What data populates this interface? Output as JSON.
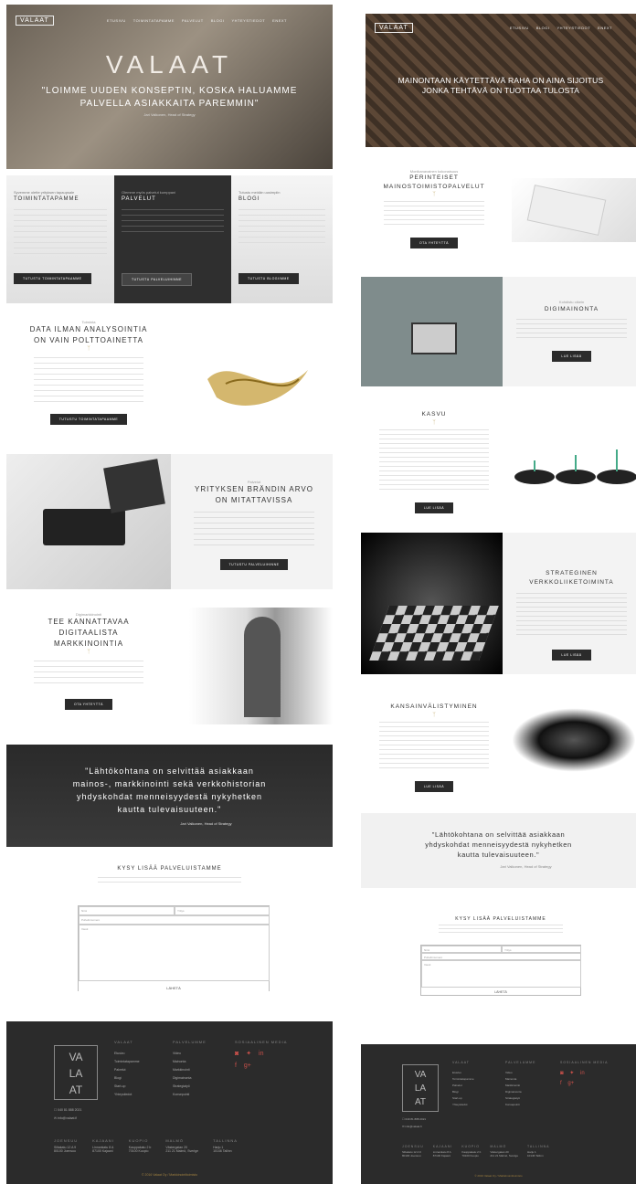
{
  "left": {
    "nav": {
      "logo": "VALAAT",
      "items": [
        "ETUSIVU",
        "TOIMINTATAPAMME",
        "PALVELUT",
        "BLOGI",
        "YHTEYSTIEDOT",
        "ENEXT"
      ]
    },
    "hero": {
      "logo": "VALAAT",
      "quote_line1": "\"LOIMME UUDEN KONSEPTIN, KOSKA HALUAMME",
      "quote_line2": "PALVELLA ASIAKKAITA PAREMMIN\"",
      "author": "Jari Valkonen, Head of Strategy"
    },
    "tiles": [
      {
        "kicker": "Syvemme olette yrityksen tapaupsale",
        "title": "TOIMINTATAPAMME",
        "button": "TUTUSTU TOIMINTATAPAAMME"
      },
      {
        "kicker": "Olemme myös palvelut kumppani",
        "title": "PALVELUT",
        "button": "TUTUSTU PALVELUIHINNE"
      },
      {
        "kicker": "Tutustu meidän uusimpiin",
        "title": "BLOGI",
        "button": "TUTUSTU BLOGIIMME"
      }
    ],
    "data": {
      "kicker": "Toiminta",
      "title1": "DATA ILMAN ANALYSOINTIA",
      "title2": "ON VAIN POLTTOAINETTA",
      "button": "TUTUSTU TOIMINTATAPAAMME"
    },
    "brand": {
      "kicker": "Palvelut",
      "title1": "YRITYKSEN BRÄNDIN ARVO",
      "title2": "ON MITATTAVISSA",
      "button": "TUTUSTU PALVELUIHINNE"
    },
    "marketing": {
      "kicker": "Digimarkkinointi",
      "title1": "TEE KANNATTAVAA",
      "title2": "DIGITAALISTA",
      "title3": "MARKKINOINTIA",
      "button": "OTA YHTEYTTÄ"
    },
    "quote": {
      "line1": "\"Lähtökohtana on selvittää asiakkaan",
      "line2": "mainos-, markkinointi sekä verkkohistorian",
      "line3": "yhdyskohdat menneisyydestä nykyhetken",
      "line4": "kautta tulevaisuuteen.\"",
      "author": "Jari Valkonen, Head of Strategy"
    },
    "contact": {
      "title": "KYSY LISÄÄ PALVELUISTAMME",
      "name": "Nimi",
      "company": "Yritys",
      "phone": "Puhelinnumero",
      "message": "Viesti",
      "submit": "LÄHETÄ"
    }
  },
  "right": {
    "hero": {
      "logo": "VALAAT",
      "quote_line1": "MAINONTAAN KÄYTETTÄVÄ RAHA ON AINA SIJOITUS",
      "quote_line2": "JONKA TEHTÄVÄ ON TUOTTAA TULOSTA"
    },
    "s1": {
      "kicker": "Monikanavainen kokonaisuus",
      "title1": "PERINTEISET",
      "title2": "MAINOSTOIMISTOPALVELUT",
      "button": "OTA YHTEYTTÄ"
    },
    "s2": {
      "kicker": "Kohdistu oikein",
      "title": "DIGIMAINONTA",
      "button": "LUE LISÄÄ"
    },
    "s3": {
      "title": "KASVU",
      "button": "LUE LISÄÄ"
    },
    "s4": {
      "title1": "STRATEGINEN",
      "title2": "VERKKOLIIKETOIMINTA",
      "button": "LUE LISÄÄ"
    },
    "s5": {
      "title": "KANSAINVÄLISTYMINEN",
      "button": "LUE LISÄÄ"
    },
    "quote": {
      "line1": "\"Lähtökohtana on selvittää asiakkaan",
      "line2": "yhdyskohdat menneisyydestä nykyhetken",
      "line3": "kautta tulevaisuuteen.\"",
      "author": "Jari Valkonen, Head of Strategy"
    },
    "contact": {
      "title": "KYSY LISÄÄ PALVELUISTAMME",
      "submit": "LÄHETÄ"
    }
  },
  "footer": {
    "logo_lines": [
      "VA",
      "LA",
      "AT"
    ],
    "phone": "040 81 888 2021",
    "email": "info@valaat.fi",
    "col1": {
      "title": "VALAAT",
      "items": [
        "Etusivu",
        "Toimintatapamme",
        "Palvelut",
        "Blogi",
        "Start-up",
        "Yhteystiedot"
      ]
    },
    "col2": {
      "title": "PALVELUMME",
      "items": [
        "Video",
        "Mainonta",
        "Markkinointi",
        "Digimainonta",
        "Strategiatyö",
        "Konsepointi"
      ]
    },
    "col3": {
      "title": "SOSIAALINEN MEDIA"
    },
    "offices": [
      {
        "city": "JOENSUU",
        "street": "Siltakatu 12 A 9",
        "zip": "80100 Joensuu"
      },
      {
        "city": "KAJAANI",
        "street": "Linnankatu 8 A",
        "zip": "87100 Kajaani"
      },
      {
        "city": "KUOPIO",
        "street": "Kauppakatu 2 b",
        "zip": "70100 Kuopio"
      },
      {
        "city": "MALMÖ",
        "street": "Västergatan 20",
        "zip": "211 21 Malmö, Sverige"
      },
      {
        "city": "TALLINNA",
        "street": "Harju 1",
        "zip": "10146 Tallinn"
      }
    ],
    "copyright": "© 2016 Valaat Oy / Markkinointitoimisto"
  }
}
